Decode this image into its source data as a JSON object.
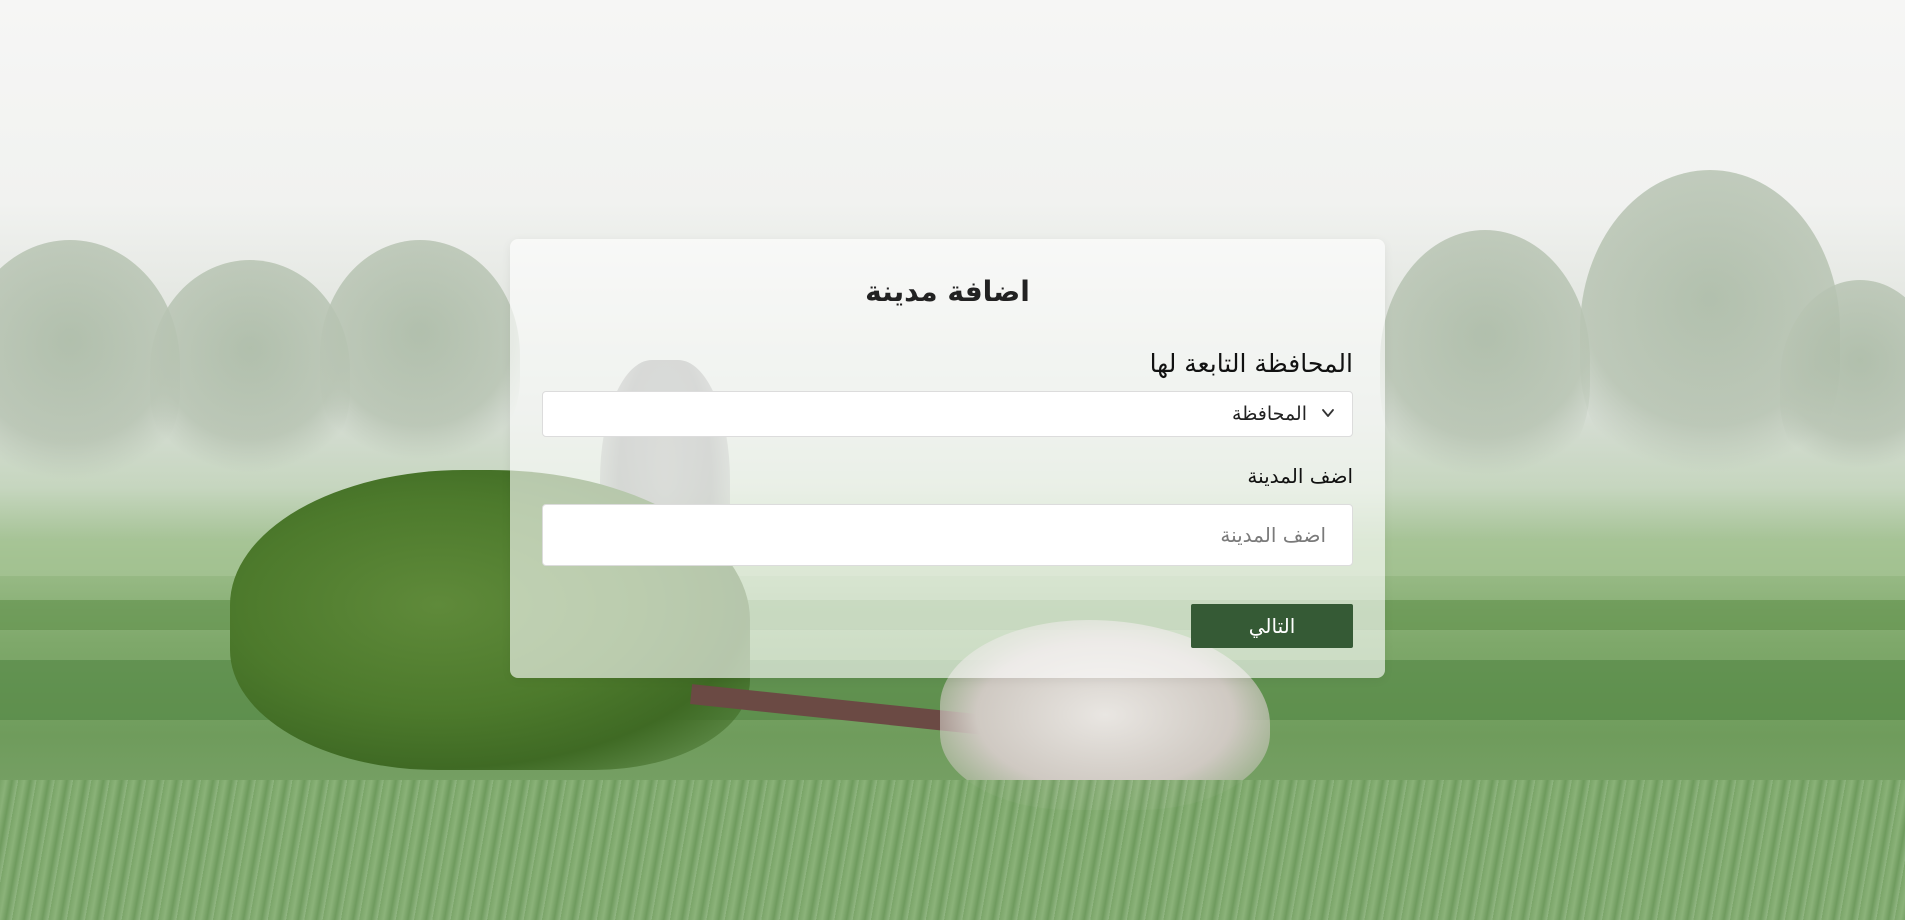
{
  "page": {
    "title": "اضافة مدينة"
  },
  "form": {
    "governorate_label": "المحافظة التابعة لها",
    "governorate_selected": "المحافظة",
    "city_label": "اضف المدينة",
    "city_placeholder": "اضف المدينة",
    "city_value": "",
    "next_label": "التالي"
  },
  "icons": {
    "select_toggle": "chevron-down-icon"
  },
  "colors": {
    "primary_button": "#355a35",
    "card_background": "rgba(255,255,255,0.62)"
  }
}
